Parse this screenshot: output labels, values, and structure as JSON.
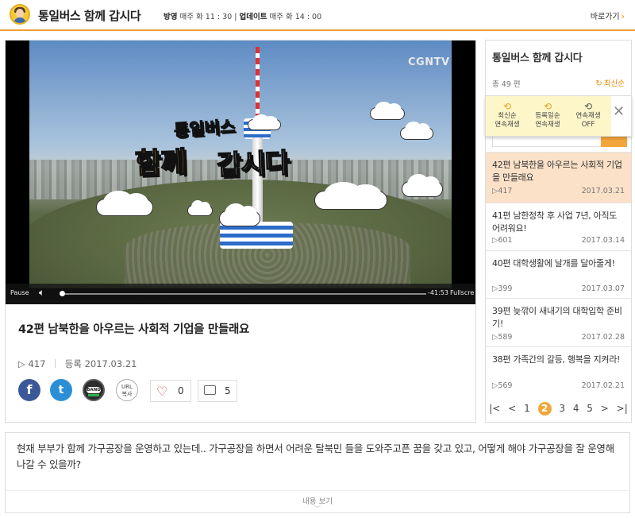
{
  "header": {
    "title": "통일버스 함께 갑시다",
    "broadcast_label": "방영",
    "broadcast_time": "매주 화 11 : 30",
    "update_label": "업데이트",
    "update_time": "매주 화 14 : 00",
    "back_label": "바로가기",
    "accent_color": "#f0a030"
  },
  "video": {
    "watermark": "CGNTV",
    "title_line1": "통일버스",
    "title_line2a": "함께",
    "title_line2b": "갑시다",
    "pause_label": "Pause",
    "time_remaining": "-41:53",
    "fullscreen_label": "Fullscreen",
    "progress": 0.0
  },
  "episode": {
    "title": "42편 남북한을 아우르는 사회적 기업을 만들래요",
    "views": "417",
    "registered_label": "등록",
    "registered_date": "2017.03.21",
    "likes": "0",
    "comments": "5"
  },
  "share": {
    "facebook": "f",
    "twitter": "t",
    "band": "BAND",
    "url_line1": "URL",
    "url_line2": "복사"
  },
  "sidebar": {
    "title": "통일버스 함께 갑시다",
    "count": "총 49 편",
    "sort_label": "최신순",
    "popup": {
      "opt1_line1": "최신순",
      "opt1_line2": "연속재생",
      "opt2_line1": "등록일순",
      "opt2_line2": "연속재생",
      "opt3_line1": "연속재생",
      "opt3_line2": "OFF"
    },
    "episodes": [
      {
        "title": "42편 남북한을 아우르는 사회적 기업을 만들래요",
        "views": "417",
        "date": "2017.03.21"
      },
      {
        "title": "41편 남한정착 후 사업 7년, 아직도 어려워요!",
        "views": "601",
        "date": "2017.03.14"
      },
      {
        "title": "40편 대학생활에 날개를 달아줄게!",
        "views": "399",
        "date": "2017.03.07"
      },
      {
        "title": "39편 늦깎이 새내기의 대학입학 준비기!",
        "views": "589",
        "date": "2017.02.28"
      },
      {
        "title": "38편 가족간의 갈등, 행복을 지켜라!",
        "views": "569",
        "date": "2017.02.21"
      }
    ],
    "pager": {
      "first": "|<",
      "prev": "<",
      "pages": [
        "1",
        "2",
        "3",
        "4",
        "5"
      ],
      "current": "2",
      "next": ">",
      "last": ">|"
    }
  },
  "description": {
    "text": "현재 부부가 함께 가구공장을 운영하고 있는데.. 가구공장을 하면서 어려운 탈북민 들을 도와주고픈 꿈을 갖고 있고, 어떻게 해야 가구공장을 잘 운영해나갈 수 있을까?",
    "more_label": "내용 보기"
  }
}
